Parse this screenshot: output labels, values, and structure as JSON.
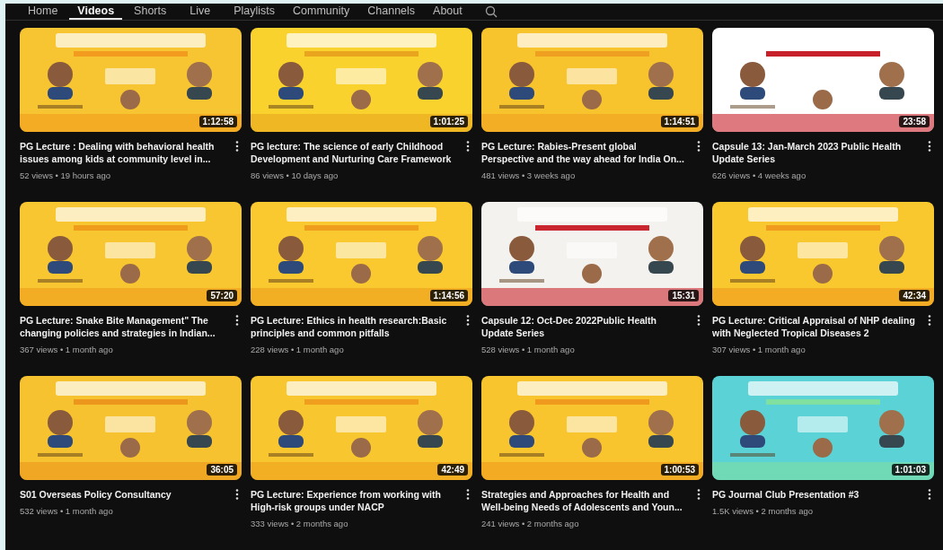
{
  "tabs": [
    {
      "label": "Home",
      "selected": false
    },
    {
      "label": "Videos",
      "selected": true
    },
    {
      "label": "Shorts",
      "selected": false
    },
    {
      "label": "Live",
      "selected": false
    },
    {
      "label": "Playlists",
      "selected": false
    },
    {
      "label": "Community",
      "selected": false
    },
    {
      "label": "Channels",
      "selected": false
    },
    {
      "label": "About",
      "selected": false
    }
  ],
  "videos": [
    {
      "kind": "picture",
      "duration": "1:12:58",
      "title": "PG Lecture : Dealing with behavioral health issues among kids at community level in...",
      "meta": "52 views • 19 hours ago"
    },
    {
      "kind": "picture",
      "duration": "1:01:25",
      "title": "PG lecture: The science of early Childhood Development and Nurturing Care Framework",
      "meta": "86 views • 10 days ago"
    },
    {
      "kind": "picture",
      "duration": "1:14:51",
      "title": "PG Lecture: Rabies-Present global Perspective and the way ahead for India On...",
      "meta": "481 views • 3 weeks ago"
    },
    {
      "kind": "picture",
      "duration": "23:58",
      "title": "Capsule 13: Jan-March 2023 Public Health Update Series",
      "meta": "626 views • 4 weeks ago"
    },
    {
      "kind": "picture",
      "duration": "57:20",
      "title": "PG Lecture: Snake Bite Management\" The changing policies and strategies in Indian...",
      "meta": "367 views • 1 month ago"
    },
    {
      "kind": "picture",
      "duration": "1:14:56",
      "title": "PG Lecture: Ethics in health research:Basic principles and common pitfalls",
      "meta": "228 views • 1 month ago"
    },
    {
      "kind": "picture",
      "duration": "15:31",
      "title": "Capsule 12: Oct-Dec 2022Public Health Update Series",
      "meta": "528 views • 1 month ago"
    },
    {
      "kind": "picture",
      "duration": "42:34",
      "title": "PG Lecture: Critical Appraisal of NHP dealing with Neglected Tropical Diseases 2",
      "meta": "307 views • 1 month ago"
    },
    {
      "kind": "picture",
      "duration": "36:05",
      "title": "S01 Overseas Policy Consultancy",
      "meta": "532 views • 1 month ago"
    },
    {
      "kind": "picture",
      "duration": "42:49",
      "title": "PG Lecture: Experience from working with High-risk groups under NACP",
      "meta": "333 views • 2 months ago"
    },
    {
      "kind": "picture",
      "duration": "1:00:53",
      "title": "Strategies and Approaches for Health and Well-being Needs of Adolescents and Youn...",
      "meta": "241 views • 2 months ago"
    },
    {
      "kind": "picture",
      "duration": "1:01:03",
      "title": "PG Journal Club Presentation #3",
      "meta": "1.5K views • 2 months ago"
    }
  ]
}
